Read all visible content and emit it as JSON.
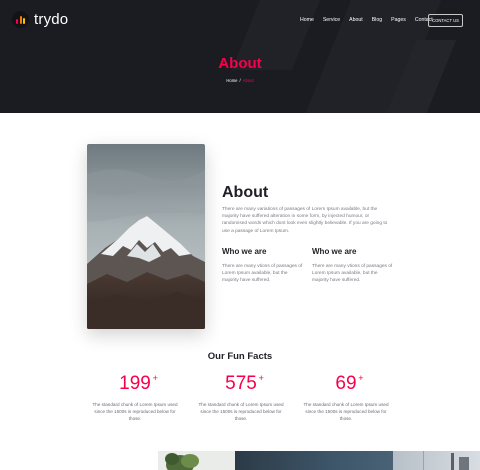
{
  "brand": {
    "name": "trydo"
  },
  "nav": {
    "items": [
      "Home",
      "Service",
      "About",
      "Blog",
      "Pages",
      "Contact"
    ],
    "cta_label": "CONTACT US"
  },
  "hero": {
    "title": "About",
    "breadcrumb": {
      "home": "Home",
      "separator": "/",
      "current": "About"
    }
  },
  "about": {
    "image_alt_icon": "mountain-photo",
    "title": "About",
    "description": "There are many variations of passages of Lorem Ipsum available, but the majority have suffered alteration in some form, by injected humour, or randomised words which dont look even slightly believable. If you are going to use a passage of Lorem Ipsum.",
    "columns": [
      {
        "title": "Who we are",
        "text": "There are many vtions of passages of Lorem Ipsum available, but the majority have suffered."
      },
      {
        "title": "Who we are",
        "text": "There are many vtions of passages of Lorem Ipsum available, but the majority have suffered."
      }
    ]
  },
  "facts": {
    "title": "Our Fun Facts",
    "items": [
      {
        "value": "199",
        "suffix": "+",
        "text": "The standard chunk of Lorem Ipsum used since the 1500s is reproduced below for those."
      },
      {
        "value": "575",
        "suffix": "+",
        "text": "The standard chunk of Lorem Ipsum used since the 1500s is reproduced below for those."
      },
      {
        "value": "69",
        "suffix": "+",
        "text": "The standard chunk of Lorem Ipsum used since the 1500s is reproduced below for those."
      }
    ]
  },
  "colors": {
    "accent": "#f9004d",
    "hero_bg": "#1b1c21",
    "heading": "#1f1f25",
    "body_text": "#7a7a84"
  }
}
